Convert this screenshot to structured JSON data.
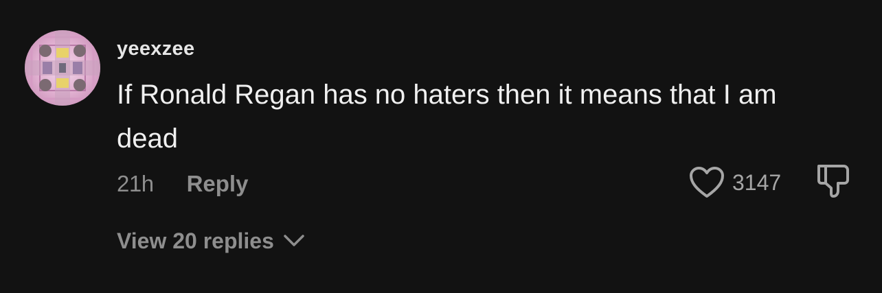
{
  "comment": {
    "username": "yeexzee",
    "text": "If Ronald Regan has no haters then it means that I am dead",
    "timestamp": "21h",
    "reply_label": "Reply",
    "like_count": "3147",
    "view_replies_label": "View 20 replies"
  },
  "icons": {
    "like": "heart-outline-icon",
    "dislike": "thumbs-down-outline-icon",
    "expand": "chevron-down-icon"
  },
  "colors": {
    "background": "#121212",
    "primary_text": "#f0f0f0",
    "secondary_text": "#8e8e8e",
    "avatar_tint": "#e5b8d6"
  }
}
